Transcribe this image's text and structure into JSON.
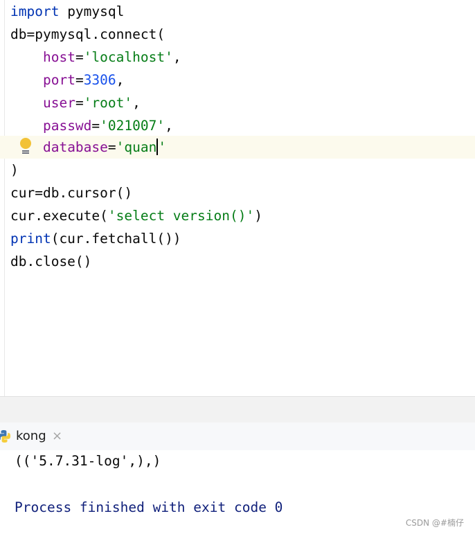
{
  "editor": {
    "lines": [
      {
        "kw": "import",
        "rest": " pymysql"
      },
      {
        "text": "db=pymysql.connect("
      },
      {
        "param": "host",
        "eq": "=",
        "str": "'localhost'",
        "tail": ","
      },
      {
        "param": "port",
        "eq": "=",
        "num": "3306",
        "tail": ","
      },
      {
        "param": "user",
        "eq": "=",
        "str": "'root'",
        "tail": ","
      },
      {
        "param": "passwd",
        "eq": "=",
        "str": "'021007'",
        "tail": ","
      },
      {
        "param": "database",
        "eq": "=",
        "str1": "'quan",
        "str2": "'"
      },
      {
        "text": ")"
      },
      {
        "text": "cur=db.cursor()"
      },
      {
        "pre": "cur.execute(",
        "str": "'select version()'",
        "post": ")"
      },
      {
        "kw": "print",
        "rest": "(cur.fetchall())"
      },
      {
        "text": "db.close()"
      }
    ],
    "intention_icon": "lightbulb-icon"
  },
  "run_panel": {
    "tab_label": "kong",
    "tab_close": "×",
    "tab_icon": "python-icon",
    "output": [
      "(('5.7.31-log',),)",
      "Process finished with exit code 0"
    ]
  },
  "watermark": "CSDN @#楠仔",
  "colors": {
    "keyword": "#0033b3",
    "param": "#871094",
    "string": "#067d17",
    "number": "#1750eb",
    "current_line": "#fcfaed",
    "exit_text": "#0f1f7a"
  }
}
